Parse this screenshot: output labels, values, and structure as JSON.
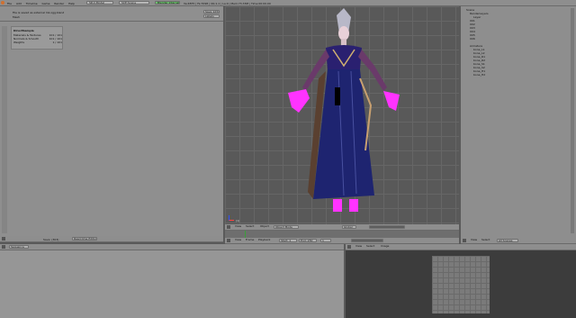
{
  "topbar": {
    "menu": [
      "File",
      "Add",
      "Timeline",
      "Game",
      "Render",
      "Help"
    ],
    "screen_field": "SR:2-Model",
    "scene_field": "SCE:Scene",
    "engine_label": "Blender Internal",
    "stats": "Ve:4875 | Fa:7098 | Ob:1-1 | La:0 | Mem:73.33M | Time:00:00.00"
  },
  "left_panel": {
    "info_line": "File is saved as external Ink.ogg.blend",
    "info_line2": "Mesh",
    "save_btn": "Save 1234",
    "label_btn": "Labels",
    "list_title": "DirectSample",
    "list_items": [
      {
        "label": "Materials & Textures",
        "value": "101 / 101"
      },
      {
        "label": "Normals & Smooth",
        "value": "101 / 101"
      },
      {
        "label": "Weights",
        "value": "1 / 101"
      }
    ],
    "footer_value": "Save: (303)",
    "footer_btn": "Read-time Editor"
  },
  "viewport": {
    "header_items": [
      "View",
      "Select",
      "Object",
      "Object Mode",
      "Global"
    ],
    "frame_label": "(1)"
  },
  "timeline": {
    "header_items": [
      "View",
      "Frame",
      "Playback",
      "Start: 1",
      "End: 250"
    ],
    "current_frame": "1"
  },
  "outliner": {
    "header_items": [
      "View",
      "Select",
      "All Scenes"
    ],
    "items": [
      {
        "label": "Scene",
        "color": "#3a3a8a"
      },
      {
        "label": "RenderLayers",
        "color": "#3a3a3a"
      },
      {
        "label": "Layer",
        "color": "#3a3a3a"
      },
      {
        "label": "001",
        "color": "#6a2a6a"
      },
      {
        "label": "002",
        "color": "#6a2a6a"
      },
      {
        "label": "003",
        "color": "#6a2a6a"
      },
      {
        "label": "004",
        "color": "#6a2a6a"
      },
      {
        "label": "005",
        "color": "#6a2a6a"
      },
      {
        "label": "006",
        "color": "#6a2a6a"
      },
      {
        "label": "Armature",
        "color": "#2a2a2a"
      },
      {
        "label": "bone_L1",
        "color": "#2a2a2a"
      },
      {
        "label": "bone_L2",
        "color": "#2a2a2a"
      },
      {
        "label": "bone_R1",
        "color": "#2a2a2a"
      },
      {
        "label": "bone_R2",
        "color": "#2a2a2a"
      },
      {
        "label": "bone_S1",
        "color": "#2a2a2a"
      },
      {
        "label": "bone_S2",
        "color": "#2a2a2a"
      },
      {
        "label": "bone_H1",
        "color": "#2a2a2a"
      },
      {
        "label": "bone_H2",
        "color": "#2a2a2a"
      }
    ]
  },
  "bottom_left": {
    "header_items": [
      "Sequence"
    ]
  },
  "uv_editor": {
    "header_items": [
      "View",
      "Select",
      "Image"
    ]
  },
  "colors": {
    "highlight_pink": "#ff33ff",
    "dress_blue": "#1e2470",
    "accent_green": "#6fbf6f"
  }
}
